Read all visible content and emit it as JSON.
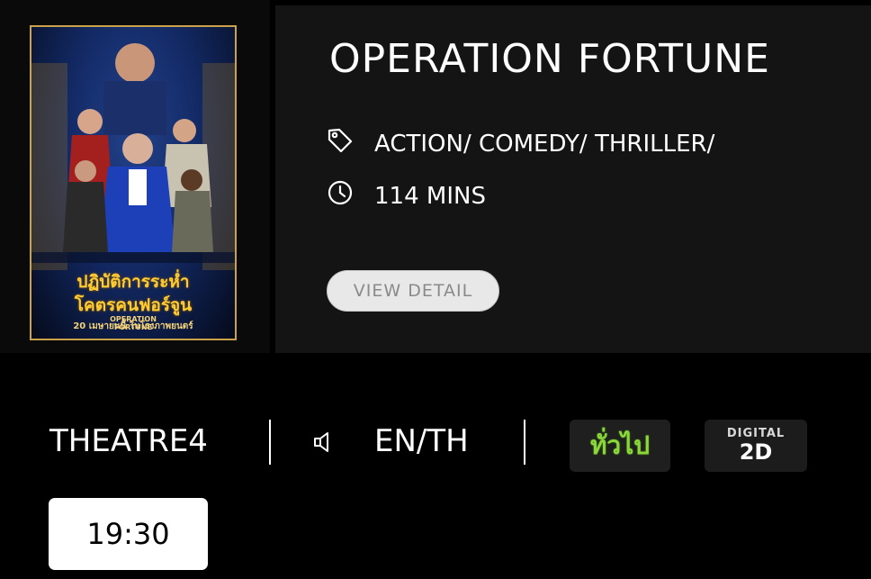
{
  "poster": {
    "thai_title_line1": "ปฏิบัติการระห่ำ",
    "thai_title_line2": "โคตรคนฟอร์จูน",
    "en_title_line1": "OPERATION",
    "en_title_line2": "FORTUNE",
    "release_text": "20 เมษายนนี้ ในโรงภาพยนตร์"
  },
  "movie": {
    "title": "OPERATION FORTUNE",
    "genre": "ACTION/ COMEDY/ THRILLER/",
    "duration": "114 MINS",
    "view_detail_label": "VIEW DETAIL"
  },
  "showing": {
    "theatre": "THEATRE4",
    "audio": "EN/TH",
    "rating_badge": "ทั่วไป",
    "format_top": "DIGITAL",
    "format_bottom": "2D",
    "times": [
      "19:30"
    ]
  },
  "icons": {
    "genre": "tag-icon",
    "duration": "clock-icon",
    "audio": "speaker-icon"
  },
  "colors": {
    "background": "#000000",
    "panel": "#141414",
    "button_bg": "#e8e8e8",
    "rating_green": "#8bd63a"
  }
}
